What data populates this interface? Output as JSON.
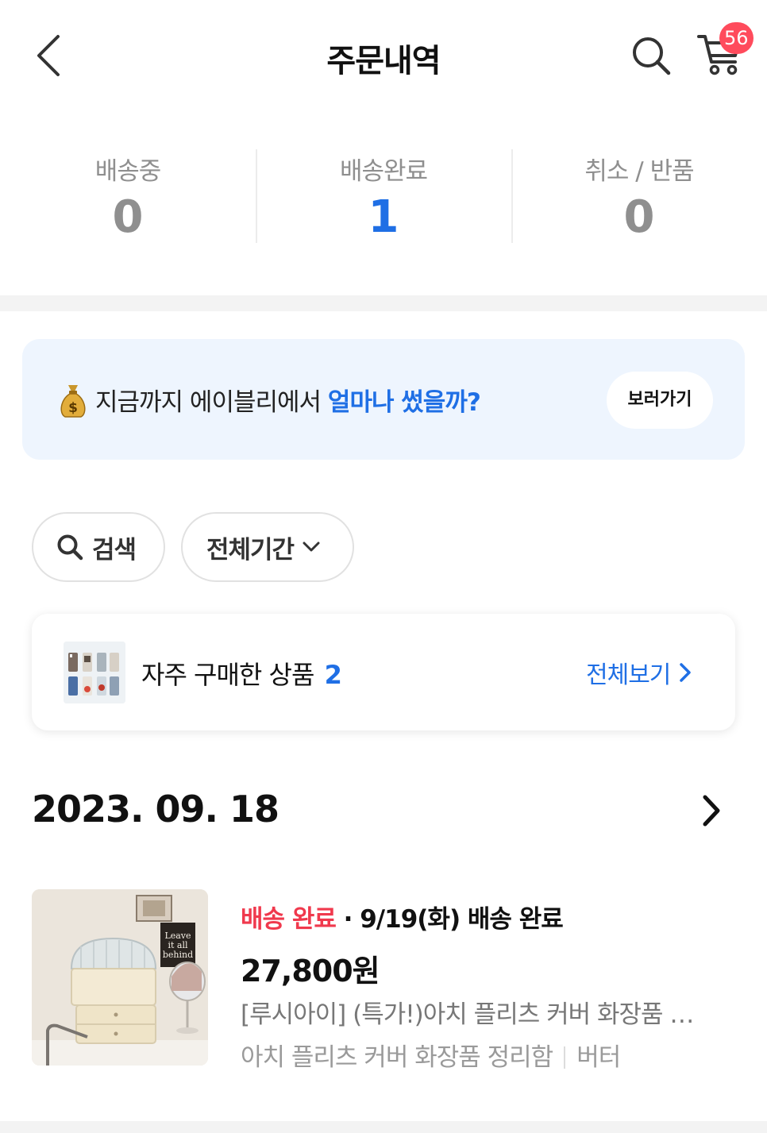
{
  "header": {
    "title": "주문내역",
    "back_icon": "chevron-left-icon",
    "search_icon": "search-icon",
    "cart_icon": "cart-icon",
    "cart_badge": "56",
    "badge_color": "#ff4b5c"
  },
  "status_summary": [
    {
      "label": "배송중",
      "count": "0"
    },
    {
      "label": "배송완료",
      "count": "1"
    },
    {
      "label": "취소 / 반품",
      "count": "0"
    }
  ],
  "banner": {
    "icon": "money-bag-icon",
    "text": "지금까지 에이블리에서 ",
    "highlight": "얼마나 썼을까?",
    "button": "보러가기"
  },
  "filters": {
    "search_label": "검색",
    "period_label": "전체기간"
  },
  "frequent": {
    "label": "자주 구매한 상품",
    "count": "2",
    "view_all": "전체보기"
  },
  "order": {
    "date": "2023. 09. 18",
    "status": "배송 완료",
    "status_detail": " · 9/19(화) 배송 완료",
    "price": "27,800원",
    "product_name": "[루시아이] (특가!)아치 플리츠 커버 화장품 정리함",
    "option_name": "아치 플리츠 커버 화장품 정리함",
    "option_color": "버터",
    "image_text": [
      "Leave",
      "it all",
      "behind"
    ]
  },
  "colors": {
    "accent": "#1f6fe5",
    "status_red": "#f0394d",
    "banner_bg": "#eef5fe"
  }
}
